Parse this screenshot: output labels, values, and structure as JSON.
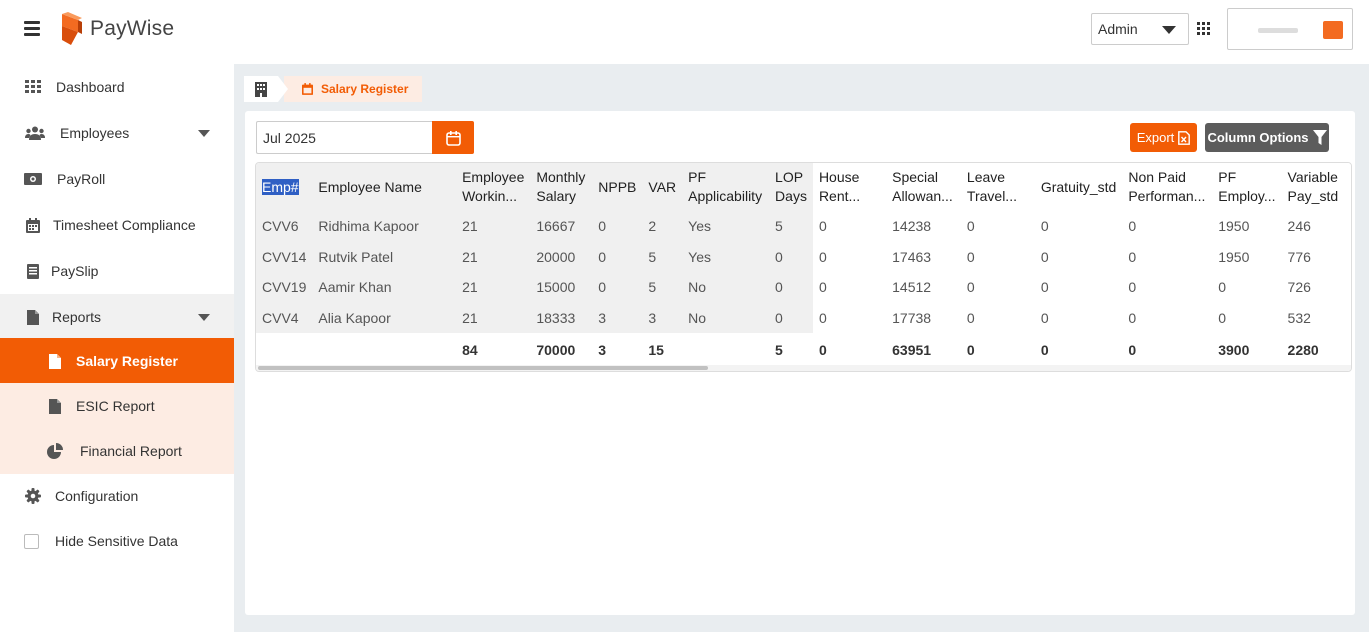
{
  "app": {
    "name": "PayWise"
  },
  "header": {
    "admin_label": "Admin"
  },
  "sidebar": {
    "items": [
      {
        "label": "Dashboard"
      },
      {
        "label": "Employees"
      },
      {
        "label": "PayRoll"
      },
      {
        "label": "Timesheet Compliance"
      },
      {
        "label": "PaySlip"
      },
      {
        "label": "Reports"
      },
      {
        "label": "Salary Register"
      },
      {
        "label": "ESIC Report"
      },
      {
        "label": "Financial Report"
      },
      {
        "label": "Configuration"
      },
      {
        "label": "Hide Sensitive Data"
      }
    ]
  },
  "breadcrumb": {
    "current": "Salary Register"
  },
  "filters": {
    "month": "Jul 2025"
  },
  "toolbar": {
    "export_label": "Export",
    "column_options_label": "Column Options"
  },
  "colors": {
    "accent": "#f25c05",
    "dark_button": "#5c5c5c",
    "selection": "#2f5fc4"
  },
  "table": {
    "headers": [
      "Emp#",
      "Employee Name",
      "Employee Workin...",
      "Monthly Salary",
      "NPPB",
      "VAR",
      "PF Applicability",
      "LOP Days",
      "House Rent...",
      "Special Allowan...",
      "Leave Travel...",
      "Gratuity_std",
      "Non Paid Performan...",
      "PF Employ...",
      "Variable Pay_std"
    ],
    "rows": [
      [
        "CVV6",
        "Ridhima Kapoor",
        "21",
        "16667",
        "0",
        "2",
        "Yes",
        "5",
        "0",
        "14238",
        "0",
        "0",
        "0",
        "1950",
        "246"
      ],
      [
        "CVV14",
        "Rutvik Patel",
        "21",
        "20000",
        "0",
        "5",
        "Yes",
        "0",
        "0",
        "17463",
        "0",
        "0",
        "0",
        "1950",
        "776"
      ],
      [
        "CVV19",
        "Aamir Khan",
        "21",
        "15000",
        "0",
        "5",
        "No",
        "0",
        "0",
        "14512",
        "0",
        "0",
        "0",
        "0",
        "726"
      ],
      [
        "CVV4",
        "Alia Kapoor",
        "21",
        "18333",
        "3",
        "3",
        "No",
        "0",
        "0",
        "17738",
        "0",
        "0",
        "0",
        "0",
        "532"
      ]
    ],
    "totals": [
      "",
      "",
      "84",
      "70000",
      "3",
      "15",
      "",
      "5",
      "0",
      "63951",
      "0",
      "0",
      "0",
      "3900",
      "2280"
    ]
  }
}
